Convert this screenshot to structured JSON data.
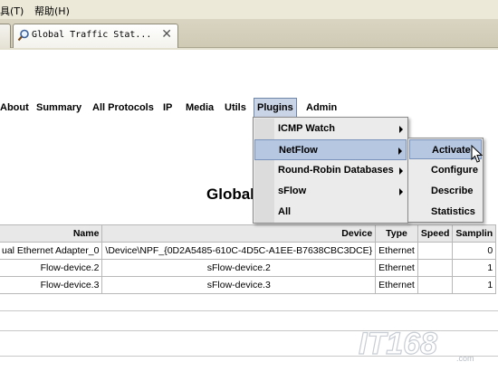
{
  "menubar": {
    "items": [
      "具(T)",
      "帮助(H)"
    ]
  },
  "browser": {
    "tab_title": "Global Traffic Stat...",
    "tab_close": "✕"
  },
  "nav": {
    "items": [
      "About",
      "Summary",
      "All Protocols",
      "IP",
      "Media",
      "Utils",
      "Plugins",
      "Admin"
    ]
  },
  "page": {
    "title": "Global"
  },
  "plugins_menu": {
    "items": [
      "ICMP Watch",
      "NetFlow",
      "Round-Robin Databases",
      "sFlow",
      "All"
    ]
  },
  "netflow_menu": {
    "items": [
      "Activate",
      "Configure",
      "Describe",
      "Statistics"
    ]
  },
  "table": {
    "headers": [
      "Name",
      "Device",
      "Type",
      "Speed",
      "Samplin"
    ],
    "rows": [
      [
        "ual Ethernet Adapter_0",
        "\\Device\\NPF_{0D2A5485-610C-4D5C-A1EE-B7638CBC3DCE}",
        "Ethernet",
        "",
        "0"
      ],
      [
        "Flow-device.2",
        "sFlow-device.2",
        "Ethernet",
        "",
        "1"
      ],
      [
        "Flow-device.3",
        "sFlow-device.3",
        "Ethernet",
        "",
        "1"
      ]
    ]
  },
  "watermark": {
    "text": "IT168",
    "sub": ".com"
  },
  "colors": {
    "highlight": "#b6c7e2",
    "menu_bg": "#ebebeb",
    "chrome": "#ece9d8"
  }
}
